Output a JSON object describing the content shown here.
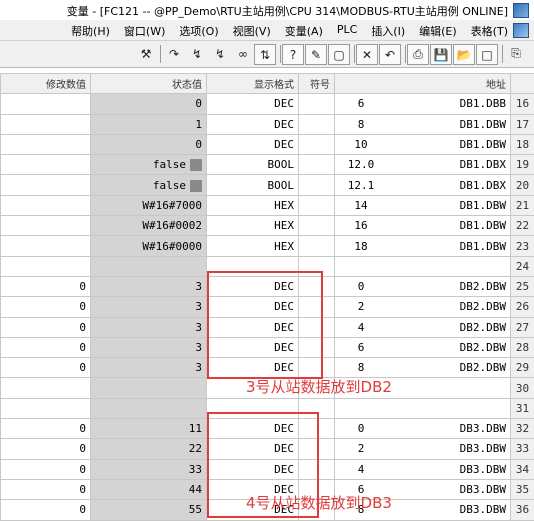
{
  "window": {
    "title": "变量 - [FC121 -- @PP_Demo\\RTU主站用例\\CPU 314\\MODBUS-RTU主站用例  ONLINE]"
  },
  "menu": {
    "items": [
      "表格(T)",
      "编辑(E)",
      "插入(I)",
      "PLC",
      "变量(A)",
      "视图(V)",
      "选项(O)",
      "窗口(W)",
      "帮助(H)"
    ]
  },
  "toolbar": {
    "tools": [
      "pin",
      "new",
      "open",
      "save",
      "print",
      "cut",
      "undo",
      "monitor",
      "force",
      "help",
      "trigger",
      "trigger-now",
      "modify",
      "update",
      "values",
      "ok"
    ]
  },
  "table": {
    "headers": {
      "address": "地址",
      "symbol": "符号",
      "display_format": "显示格式",
      "status_value": "状态值",
      "modify_value": "修改数值"
    },
    "rows": [
      {
        "num": "16",
        "area": "DB1.DBB",
        "offset": "6",
        "symbol": "",
        "format": "DEC",
        "status": "0",
        "modify": "",
        "bool": false
      },
      {
        "num": "17",
        "area": "DB1.DBW",
        "offset": "8",
        "symbol": "",
        "format": "DEC",
        "status": "1",
        "modify": "",
        "bool": false
      },
      {
        "num": "18",
        "area": "DB1.DBW",
        "offset": "10",
        "symbol": "",
        "format": "DEC",
        "status": "0",
        "modify": "",
        "bool": false
      },
      {
        "num": "19",
        "area": "DB1.DBX",
        "offset": "12.0",
        "symbol": "",
        "format": "BOOL",
        "status": "false",
        "modify": "",
        "bool": true
      },
      {
        "num": "20",
        "area": "DB1.DBX",
        "offset": "12.1",
        "symbol": "",
        "format": "BOOL",
        "status": "false",
        "modify": "",
        "bool": true
      },
      {
        "num": "21",
        "area": "DB1.DBW",
        "offset": "14",
        "symbol": "",
        "format": "HEX",
        "status": "W#16#7000",
        "modify": "",
        "bool": false
      },
      {
        "num": "22",
        "area": "DB1.DBW",
        "offset": "16",
        "symbol": "",
        "format": "HEX",
        "status": "W#16#0002",
        "modify": "",
        "bool": false
      },
      {
        "num": "23",
        "area": "DB1.DBW",
        "offset": "18",
        "symbol": "",
        "format": "HEX",
        "status": "W#16#0000",
        "modify": "",
        "bool": false
      },
      {
        "num": "24",
        "area": "",
        "offset": "",
        "symbol": "",
        "format": "",
        "status": "",
        "modify": "",
        "bool": false
      },
      {
        "num": "25",
        "area": "DB2.DBW",
        "offset": "0",
        "symbol": "",
        "format": "DEC",
        "status": "3",
        "modify": "0",
        "bool": false
      },
      {
        "num": "26",
        "area": "DB2.DBW",
        "offset": "2",
        "symbol": "",
        "format": "DEC",
        "status": "3",
        "modify": "0",
        "bool": false
      },
      {
        "num": "27",
        "area": "DB2.DBW",
        "offset": "4",
        "symbol": "",
        "format": "DEC",
        "status": "3",
        "modify": "0",
        "bool": false
      },
      {
        "num": "28",
        "area": "DB2.DBW",
        "offset": "6",
        "symbol": "",
        "format": "DEC",
        "status": "3",
        "modify": "0",
        "bool": false
      },
      {
        "num": "29",
        "area": "DB2.DBW",
        "offset": "8",
        "symbol": "",
        "format": "DEC",
        "status": "3",
        "modify": "0",
        "bool": false
      },
      {
        "num": "30",
        "area": "",
        "offset": "",
        "symbol": "",
        "format": "",
        "status": "",
        "modify": "",
        "bool": false
      },
      {
        "num": "31",
        "area": "",
        "offset": "",
        "symbol": "",
        "format": "",
        "status": "",
        "modify": "",
        "bool": false
      },
      {
        "num": "32",
        "area": "DB3.DBW",
        "offset": "0",
        "symbol": "",
        "format": "DEC",
        "status": "11",
        "modify": "0",
        "bool": false
      },
      {
        "num": "33",
        "area": "DB3.DBW",
        "offset": "2",
        "symbol": "",
        "format": "DEC",
        "status": "22",
        "modify": "0",
        "bool": false
      },
      {
        "num": "34",
        "area": "DB3.DBW",
        "offset": "4",
        "symbol": "",
        "format": "DEC",
        "status": "33",
        "modify": "0",
        "bool": false
      },
      {
        "num": "35",
        "area": "DB3.DBW",
        "offset": "6",
        "symbol": "",
        "format": "DEC",
        "status": "44",
        "modify": "0",
        "bool": false
      },
      {
        "num": "36",
        "area": "DB3.DBW",
        "offset": "8",
        "symbol": "",
        "format": "DEC",
        "status": "55",
        "modify": "0",
        "bool": false
      }
    ]
  },
  "annotations": {
    "db2_label": "3号从站数据放到DB2",
    "db3_label": "4号从站数据放到DB3",
    "color": "#e03c3c"
  }
}
